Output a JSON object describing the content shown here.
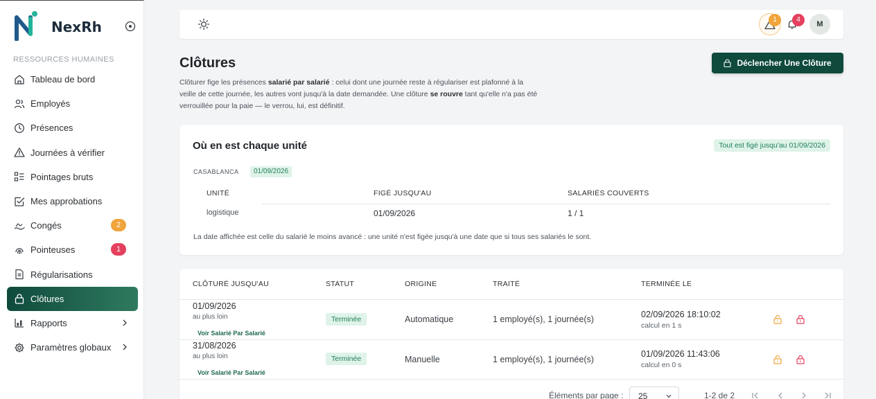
{
  "app": {
    "name": "NexRh"
  },
  "sidebar": {
    "section_label": "RESSOURCES HUMAINES",
    "items": [
      {
        "label": "Tableau de bord",
        "icon": "home-icon"
      },
      {
        "label": "Employés",
        "icon": "users-icon"
      },
      {
        "label": "Présences",
        "icon": "clock-icon"
      },
      {
        "label": "Journées à vérifier",
        "icon": "warning-icon"
      },
      {
        "label": "Pointages bruts",
        "icon": "list-icon"
      },
      {
        "label": "Mes approbations",
        "icon": "checkbox-icon"
      },
      {
        "label": "Congés",
        "icon": "beach-icon",
        "badge": "2",
        "badge_color": "#f0a43a"
      },
      {
        "label": "Pointeuses",
        "icon": "fingerprint-icon",
        "badge": "1",
        "badge_color": "#e5405e"
      },
      {
        "label": "Régularisations",
        "icon": "document-icon"
      },
      {
        "label": "Clôtures",
        "icon": "lock-icon",
        "active": true
      },
      {
        "label": "Rapports",
        "icon": "chart-icon",
        "has_chevron": true
      },
      {
        "label": "Paramètres globaux",
        "icon": "gear-icon",
        "has_chevron": true
      }
    ]
  },
  "topbar": {
    "warnings_count": "1",
    "notifications_count": "4",
    "avatar_initial": "M"
  },
  "page": {
    "title": "Clôtures",
    "desc_1": "Clôturer fige les présences ",
    "desc_b1": "salarié par salarié",
    "desc_2": " : celui dont une journée reste à régulariser est plafonné à la veille de cette journée, les autres vont jusqu'à la date demandée. Une clôture ",
    "desc_b2": "se rouvre",
    "desc_3": " tant qu'elle n'a pas été verrouillée pour la paie — le verrou, lui, est définitif.",
    "trigger_button": "Déclencher Une Clôture"
  },
  "units": {
    "title": "Où en est chaque unité",
    "status": "Tout est figé jusqu'au 01/09/2026",
    "city": "CASABLANCA",
    "city_date": "01/09/2026",
    "headers": {
      "unit": "UNITÉ",
      "frozen": "FIGÉ JUSQU'AU",
      "covered": "SALARIÉS COUVERTS"
    },
    "rows": [
      {
        "unit": "logistique",
        "frozen": "01/09/2026",
        "covered": "1 / 1"
      }
    ],
    "note": "La date affichée est celle du salarié le moins avancé : une unité n'est figée jusqu'à une date que si tous ses salariés le sont."
  },
  "closures": {
    "headers": {
      "until": "CLÔTURÉ JUSQU'AU",
      "status": "STATUT",
      "origin": "ORIGINE",
      "processed": "TRAITÉ",
      "ended": "TERMINÉE LE"
    },
    "rows": [
      {
        "until": "01/09/2026",
        "until_sub": "au plus loin",
        "link": "Voir Salarié Par Salarié",
        "status": "Terminée",
        "origin": "Automatique",
        "processed": "1 employé(s), 1 journée(s)",
        "ended": "02/09/2026 18:10:02",
        "ended_sub": "calcul en 1 s"
      },
      {
        "until": "31/08/2026",
        "until_sub": "au plus loin",
        "link": "Voir Salarié Par Salarié",
        "status": "Terminée",
        "origin": "Manuelle",
        "processed": "1 employé(s), 1 journée(s)",
        "ended": "01/09/2026 11:43:06",
        "ended_sub": "calcul en 0 s"
      }
    ],
    "pager": {
      "label": "Éléments par page :",
      "page_size": "25",
      "range": "1-2 de 2"
    }
  },
  "colors": {
    "brand": "#0f4a3c",
    "success_bg": "#dff3e9",
    "success_text": "#21805a",
    "warning": "#f0a43a",
    "danger": "#e5405e"
  }
}
